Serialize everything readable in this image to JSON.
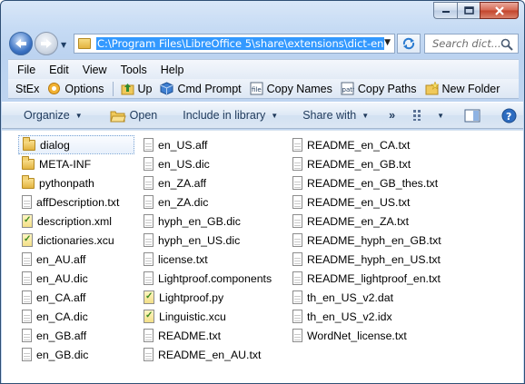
{
  "address": {
    "path": "C:\\Program Files\\LibreOffice 5\\share\\extensions\\dict-en"
  },
  "search": {
    "placeholder": "Search dict..."
  },
  "menu": [
    "File",
    "Edit",
    "View",
    "Tools",
    "Help"
  ],
  "custom_toolbar": {
    "stex": "StEx",
    "options": "Options",
    "up": "Up",
    "cmd_prompt": "Cmd Prompt",
    "copy_names": "Copy Names",
    "copy_paths": "Copy Paths",
    "new_folder": "New Folder"
  },
  "command_bar": {
    "organize": "Organize",
    "open": "Open",
    "include_in_library": "Include in library",
    "share_with": "Share with",
    "more": "»"
  },
  "files": {
    "col1": [
      {
        "name": "dialog",
        "type": "folder"
      },
      {
        "name": "META-INF",
        "type": "folder"
      },
      {
        "name": "pythonpath",
        "type": "folder"
      },
      {
        "name": "affDescription.txt",
        "type": "doc"
      },
      {
        "name": "description.xml",
        "type": "xml"
      },
      {
        "name": "dictionaries.xcu",
        "type": "xml"
      },
      {
        "name": "en_AU.aff",
        "type": "doc"
      },
      {
        "name": "en_AU.dic",
        "type": "doc"
      },
      {
        "name": "en_CA.aff",
        "type": "doc"
      },
      {
        "name": "en_CA.dic",
        "type": "doc"
      },
      {
        "name": "en_GB.aff",
        "type": "doc"
      },
      {
        "name": "en_GB.dic",
        "type": "doc"
      }
    ],
    "col2": [
      {
        "name": "en_US.aff",
        "type": "doc"
      },
      {
        "name": "en_US.dic",
        "type": "doc"
      },
      {
        "name": "en_ZA.aff",
        "type": "doc"
      },
      {
        "name": "en_ZA.dic",
        "type": "doc"
      },
      {
        "name": "hyph_en_GB.dic",
        "type": "doc"
      },
      {
        "name": "hyph_en_US.dic",
        "type": "doc"
      },
      {
        "name": "license.txt",
        "type": "doc"
      },
      {
        "name": "Lightproof.components",
        "type": "doc"
      },
      {
        "name": "Lightproof.py",
        "type": "xml"
      },
      {
        "name": "Linguistic.xcu",
        "type": "xml"
      },
      {
        "name": "README.txt",
        "type": "doc"
      },
      {
        "name": "README_en_AU.txt",
        "type": "doc"
      }
    ],
    "col3": [
      {
        "name": "README_en_CA.txt",
        "type": "doc"
      },
      {
        "name": "README_en_GB.txt",
        "type": "doc"
      },
      {
        "name": "README_en_GB_thes.txt",
        "type": "doc"
      },
      {
        "name": "README_en_US.txt",
        "type": "doc"
      },
      {
        "name": "README_en_ZA.txt",
        "type": "doc"
      },
      {
        "name": "README_hyph_en_GB.txt",
        "type": "doc"
      },
      {
        "name": "README_hyph_en_US.txt",
        "type": "doc"
      },
      {
        "name": "README_lightproof_en.txt",
        "type": "doc"
      },
      {
        "name": "th_en_US_v2.dat",
        "type": "doc"
      },
      {
        "name": "th_en_US_v2.idx",
        "type": "doc"
      },
      {
        "name": "WordNet_license.txt",
        "type": "doc"
      }
    ]
  },
  "colors": {
    "selection": "#3399ff",
    "accent": "#1e395b"
  }
}
